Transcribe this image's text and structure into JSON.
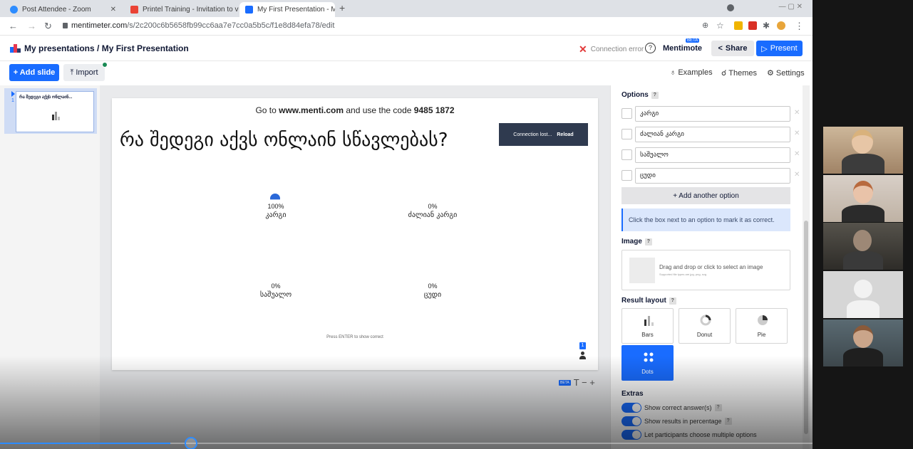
{
  "browser": {
    "tabs": [
      {
        "label": "Post Attendee - Zoom",
        "color": "#2d8cff"
      },
      {
        "label": "Printel Training - Invitation to vi...",
        "color": "#ea4335"
      },
      {
        "label": "My First Presentation - Mentime...",
        "color": "#196cff",
        "active": true
      }
    ],
    "url_host": "mentimeter.com",
    "url_path": "/s/2c200c6b5658fb99cc6aa7e7cc0a5b5c/f1e8d84efa78/edit"
  },
  "header": {
    "breadcrumb": "My presentations / My First Presentation",
    "connection_error": "Connection error",
    "help": "?",
    "mentimote": "Mentimote",
    "beta": "BETA",
    "share": "Share",
    "present": "Present"
  },
  "toolbar": {
    "add_slide": "+ Add slide",
    "import": "Import",
    "examples": "Examples",
    "themes": "Themes",
    "settings": "Settings"
  },
  "slides_panel": {
    "number": "1",
    "thumb_title": "რა შედეგი აქვს ონლაინ..."
  },
  "slide": {
    "join_prefix": "Go to ",
    "join_site": "www.menti.com",
    "join_mid": " and use the code ",
    "join_code": "9485 1872",
    "question": "რა შედეგი აქვს ონლაინ სწავლებას?",
    "connection_lost": "Connection lost...",
    "reload": "Reload",
    "results": [
      {
        "pct": "100%",
        "label": "კარგი",
        "value": 100
      },
      {
        "pct": "0%",
        "label": "ძალიან კარგი",
        "value": 0
      },
      {
        "pct": "0%",
        "label": "საშუალო",
        "value": 0
      },
      {
        "pct": "0%",
        "label": "ცუდი",
        "value": 0
      }
    ],
    "press_enter": "Press ENTER to show correct",
    "participants": "1",
    "font_beta": "BETA",
    "font_controls": "T − +"
  },
  "options_panel": {
    "title": "Options",
    "q": "?",
    "options": [
      "კარგი",
      "ძალიან კარგი",
      "საშუალო",
      "ცუდი"
    ],
    "add_option": "+ Add another option",
    "info": "Click the box next to an option to mark it as correct."
  },
  "image_panel": {
    "title": "Image",
    "drop_text": "Drag and drop or click to select an image",
    "supported": "Supported file types are jpg, png, svg"
  },
  "result_layout": {
    "title": "Result layout",
    "layouts": [
      "Bars",
      "Donut",
      "Pie",
      "Dots"
    ],
    "selected": "Dots"
  },
  "extras": {
    "title": "Extras",
    "toggles": [
      "Show correct answer(s)",
      "Show results in percentage",
      "Let participants choose multiple options"
    ]
  },
  "video_progress": 0.21,
  "colors": {
    "accent": "#196cff",
    "dark": "#101834",
    "error": "#e23a3a"
  }
}
